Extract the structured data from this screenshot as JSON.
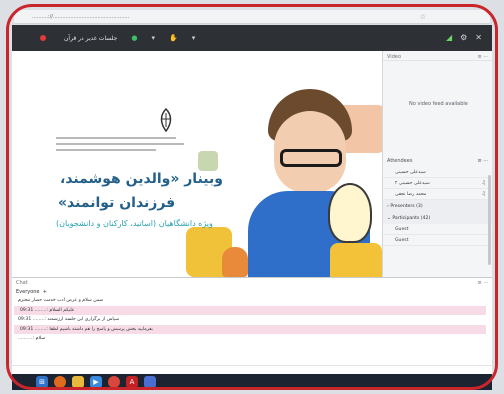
{
  "browser": {
    "url": "..........://................................................",
    "star_icon": "star-icon"
  },
  "app": {
    "title": "جلسات غدیر در قرآن",
    "controls": [
      "mic-icon",
      "camera-icon",
      "hand-icon"
    ],
    "right_icons": [
      "signal-icon",
      "gear-icon",
      "close-icon"
    ]
  },
  "slide": {
    "title_line1": "وبینار «والدین هوشمند،",
    "title_line2": "فرزندان توانمند»",
    "subtitle": "ویژه دانشگاهیان (اساتید، کارکنان و دانشجویان)"
  },
  "video_panel": {
    "header": "Video",
    "message": "No video feed available"
  },
  "attendees": {
    "header": "Attendees",
    "presenters": [
      "سیدعلی حسینی",
      "سیدعلی حسینی ۲",
      "محمد رضا نجفی"
    ],
    "presenters_section": "Presenters (3)",
    "participants_section": "Participants (42)",
    "participants": [
      "Guest",
      "Guest"
    ]
  },
  "chat": {
    "header": "Chat",
    "tab": "Everyone",
    "messages": [
      {
        "text": "ضمن سلام و عرض ادب خدمت حضار محترم",
        "highlight": false
      },
      {
        "text": "09:31 ........: علیکم السلام",
        "highlight": true
      },
      {
        "text": "09:31 ........: سپاس از برگزاری این جلسه ارزشمند",
        "highlight": false
      },
      {
        "text": "09:31 ........: بفرمایید بخش پرسش و پاسخ را هم داشته باشیم لطفا",
        "highlight": true
      },
      {
        "text": "..........: سلام",
        "highlight": false
      }
    ],
    "input_placeholder": ""
  },
  "taskbar": {
    "apps": [
      "start-icon",
      "firefox-icon",
      "folder-icon",
      "media-icon",
      "chrome-icon",
      "pdf-icon",
      "app-icon"
    ],
    "clock": ""
  },
  "colors": {
    "frame": "#c9262c",
    "appbar": "#2d3035",
    "title_blue": "#23618b",
    "highlight": "#f7dbe6"
  }
}
